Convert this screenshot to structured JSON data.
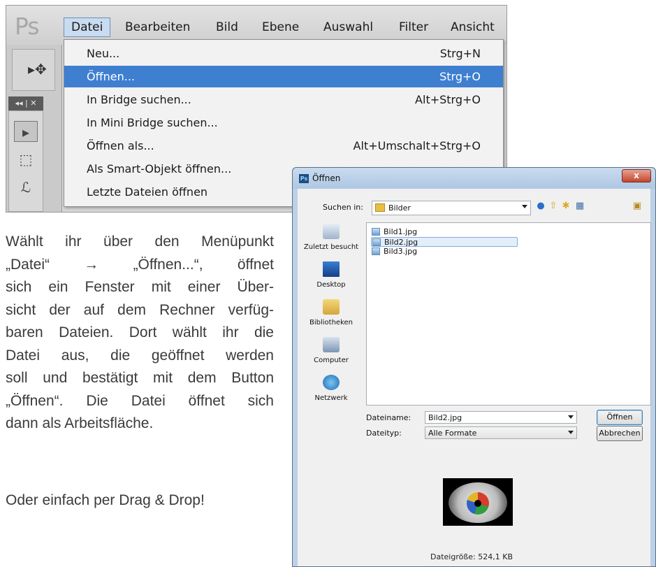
{
  "photoshop": {
    "logo": "Ps",
    "menubar": [
      "Datei",
      "Bearbeiten",
      "Bild",
      "Ebene",
      "Auswahl",
      "Filter",
      "Ansicht"
    ],
    "active_menu": "Datei",
    "panel_header": "◂◂ | ✕",
    "datei_menu": [
      {
        "label": "Neu...",
        "shortcut": "Strg+N"
      },
      {
        "label": "Öffnen...",
        "shortcut": "Strg+O",
        "highlighted": true
      },
      {
        "label": "In Bridge suchen...",
        "shortcut": "Alt+Strg+O"
      },
      {
        "label": "In Mini Bridge suchen...",
        "shortcut": ""
      },
      {
        "label": "Öffnen als...",
        "shortcut": "Alt+Umschalt+Strg+O"
      },
      {
        "label": "Als Smart-Objekt öffnen...",
        "shortcut": ""
      },
      {
        "label": "Letzte Dateien öffnen",
        "shortcut": ""
      }
    ]
  },
  "description": {
    "lines": [
      "Wählt ihr über den Menüpunkt",
      "„Datei“ → „Öffnen...“, öffnet",
      "sich ein Fenster mit einer Über-",
      "sicht der auf dem Rechner verfüg-",
      "baren Dateien. Dort wählt ihr die",
      "Datei aus, die geöffnet werden",
      "soll und bestätigt mit dem Button",
      "„Öffnen“. Die Datei öffnet sich",
      "dann als Arbeitsfläche."
    ],
    "drag_drop": "Oder einfach per Drag & Drop!"
  },
  "dialog": {
    "title": "Öffnen",
    "close_label": "x",
    "look_in_label": "Suchen in:",
    "look_in_value": "Bilder",
    "places": [
      "Zuletzt besucht",
      "Desktop",
      "Bibliotheken",
      "Computer",
      "Netzwerk"
    ],
    "files": [
      {
        "name": "Bild1.jpg",
        "selected": false
      },
      {
        "name": "Bild2.jpg",
        "selected": true
      },
      {
        "name": "Bild3.jpg",
        "selected": false
      }
    ],
    "filename_label": "Dateiname:",
    "filename_value": "Bild2.jpg",
    "filetype_label": "Dateityp:",
    "filetype_value": "Alle Formate",
    "open_button": "Öffnen",
    "cancel_button": "Abbrechen",
    "filesize": "Dateigröße: 524,1 KB"
  },
  "colors": {
    "menu_highlight": "#3f7fd0",
    "dialog_frame": "#bcd0e7",
    "close_button": "#c6452d"
  }
}
